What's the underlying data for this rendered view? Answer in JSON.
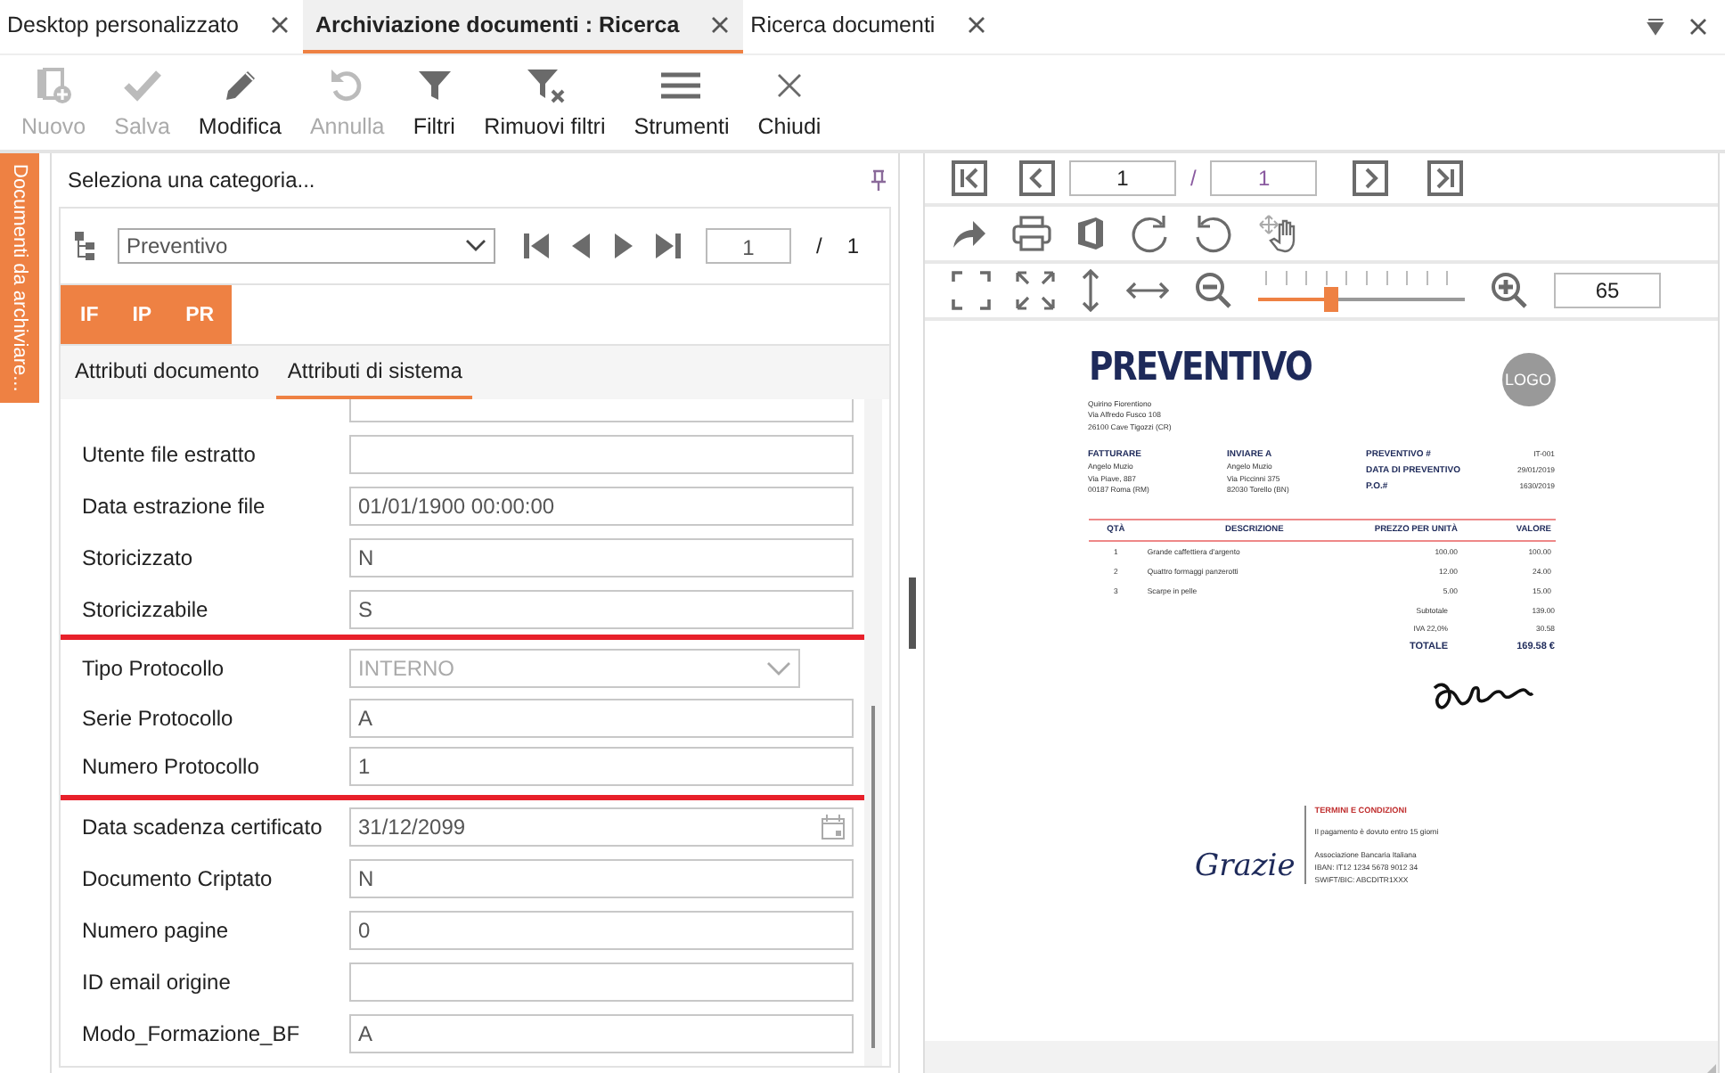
{
  "tabs": [
    {
      "label": "Desktop personalizzato",
      "selected": false,
      "closable": true
    },
    {
      "label": "Archiviazione documenti : Ricerca",
      "selected": true,
      "closable": true
    },
    {
      "label": "Ricerca documenti",
      "selected": false,
      "closable": true
    }
  ],
  "toolbar": [
    {
      "kind": "new",
      "label": "Nuovo",
      "disabled": true
    },
    {
      "kind": "save",
      "label": "Salva",
      "disabled": true
    },
    {
      "kind": "edit",
      "label": "Modifica",
      "disabled": false
    },
    {
      "kind": "undo",
      "label": "Annulla",
      "disabled": true
    },
    {
      "kind": "filter",
      "label": "Filtri",
      "disabled": false
    },
    {
      "kind": "clear-filter",
      "label": "Rimuovi filtri",
      "disabled": false
    },
    {
      "kind": "menu",
      "label": "Strumenti",
      "disabled": false
    },
    {
      "kind": "close",
      "label": "Chiudi",
      "disabled": false
    }
  ],
  "side_strip": {
    "label": "Documenti da archiviare..."
  },
  "category_panel": {
    "title": "Seleziona una categoria...",
    "category": "Preventivo",
    "page": "1",
    "separator": "/",
    "total": "1"
  },
  "category_tabs": [
    {
      "label": "IF"
    },
    {
      "label": "IP"
    },
    {
      "label": "PR"
    }
  ],
  "attribute_tabs": [
    {
      "label": "Attributi documento",
      "selected": false
    },
    {
      "label": "Attributi di sistema",
      "selected": true
    }
  ],
  "fields": [
    {
      "kind": "text",
      "highlighted": false
    },
    {
      "kind": "text",
      "label": "Utente file estratto",
      "highlighted": false
    },
    {
      "kind": "text",
      "label": "Data estrazione file",
      "value": "01/01/1900 00:00:00",
      "highlighted": false
    },
    {
      "kind": "text",
      "label": "Storicizzato",
      "value": "N",
      "highlighted": false
    },
    {
      "kind": "text",
      "label": "Storicizzabile",
      "value": "S",
      "highlighted": false
    },
    {
      "kind": "dropdown",
      "label": "Tipo Protocollo",
      "value": "INTERNO",
      "disabled": true,
      "highlighted": true
    },
    {
      "kind": "text",
      "label": "Serie Protocollo",
      "value": "A",
      "highlighted": true
    },
    {
      "kind": "text",
      "label": "Numero Protocollo",
      "value": "1",
      "highlighted": true
    },
    {
      "kind": "date",
      "label": "Data scadenza certificato",
      "value": "31/12/2099",
      "highlighted": false
    },
    {
      "kind": "text",
      "label": "Documento Criptato",
      "value": "N",
      "highlighted": false
    },
    {
      "kind": "text",
      "label": "Numero pagine",
      "value": "0",
      "highlighted": false
    },
    {
      "kind": "text",
      "label": "ID email origine",
      "highlighted": false
    },
    {
      "kind": "text",
      "label": "Modo_Formazione_BF",
      "value": "A",
      "highlighted": false
    }
  ],
  "viewer": {
    "page": "1",
    "separator": "/",
    "total": "1",
    "zoom": {
      "level": 0.35,
      "value": "65"
    }
  },
  "document": {
    "title": "PREVENTIVO",
    "logo": "LOGO",
    "sender": [
      "Quirino Fiorentiono",
      "Via Alfredo Fusco 108",
      "26100 Cave Tigozzi (CR)"
    ],
    "addresses": [
      {
        "heading": "FATTURARE",
        "lines": [
          "Angelo Muzio",
          "Via Piave, 887",
          "00187 Roma (RM)"
        ]
      },
      {
        "heading": "INVIARE A",
        "lines": [
          "Angelo Muzio",
          "Via Piccinni 375",
          "82030 Torello (BN)"
        ]
      }
    ],
    "meta": [
      {
        "label": "PREVENTIVO #",
        "value": "IT-001"
      },
      {
        "label": "DATA DI PREVENTIVO",
        "value": "29/01/2019"
      },
      {
        "label": "P.O.#",
        "value": "1630/2019"
      }
    ],
    "columns": [
      "QTÀ",
      "DESCRIZIONE",
      "PREZZO PER UNITÀ",
      "VALORE"
    ],
    "rows": [
      [
        "1",
        "Grande caffettiera d'argento",
        "100.00",
        "100.00"
      ],
      [
        "2",
        "Quattro formaggi panzerotti",
        "12.00",
        "24.00"
      ],
      [
        "3",
        "Scarpe in pelle",
        "5.00",
        "15.00"
      ]
    ],
    "totals": [
      {
        "label": "Subtotale",
        "value": "139.00",
        "grand": false
      },
      {
        "label": "IVA 22,0%",
        "value": "30.58",
        "grand": false
      },
      {
        "label": "TOTALE",
        "value": "169.58 €",
        "grand": true
      }
    ],
    "thanks": "Grazie",
    "terms_title": "TERMINI E CONDIZIONI",
    "terms": "Il pagamento è dovuto entro 15 giorni",
    "bank": [
      "Associazione Bancaria Italiana",
      "IBAN: IT12 1234 5678 9012 34",
      "SWIFT/BIC: ABCDITR1XXX"
    ]
  }
}
